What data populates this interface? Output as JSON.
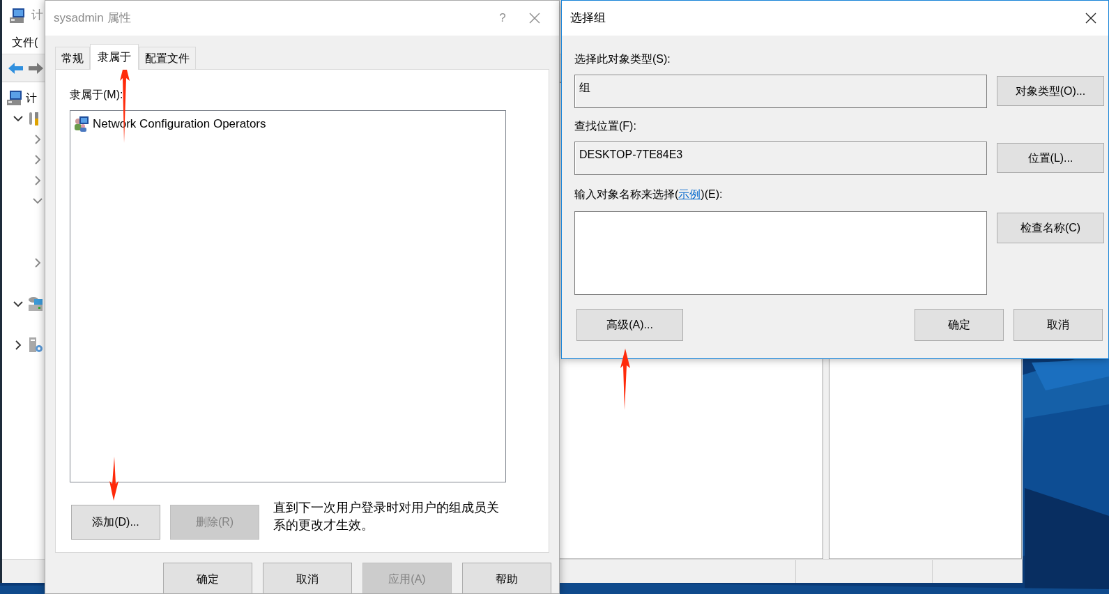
{
  "background_window": {
    "title": "计",
    "menu": [
      "文件("
    ],
    "tree": {
      "root": "计",
      "items": [
        {
          "kind": "tools",
          "expanded": true,
          "children": [
            {
              "kind": "node",
              "expanded": false
            },
            {
              "kind": "node",
              "expanded": false
            },
            {
              "kind": "node",
              "expanded": false
            },
            {
              "kind": "node",
              "expanded": true,
              "children": [
                {
                  "kind": "leaf"
                },
                {
                  "kind": "leaf"
                }
              ]
            },
            {
              "kind": "node",
              "expanded": false
            }
          ]
        },
        {
          "kind": "leaf"
        },
        {
          "kind": "storage",
          "expanded": true,
          "children": [
            {
              "kind": "leaf"
            }
          ]
        },
        {
          "kind": "services",
          "expanded": false
        }
      ]
    }
  },
  "properties_dialog": {
    "title": "sysadmin 属性",
    "help": "?",
    "tabs": [
      {
        "label": "常规",
        "selected": false
      },
      {
        "label": "隶属于",
        "selected": true
      },
      {
        "label": "配置文件",
        "selected": false
      }
    ],
    "member_of_label": "隶属于(M):",
    "members": [
      {
        "name": "Network Configuration Operators"
      }
    ],
    "buttons": [
      {
        "label": "添加(D)...",
        "disabled": false
      },
      {
        "label": "删除(R)",
        "disabled": true
      }
    ],
    "note": "直到下一次用户登录时对用户的组成员关系的更改才生效。",
    "footer_buttons": [
      {
        "label": "确定",
        "disabled": false
      },
      {
        "label": "取消",
        "disabled": false
      },
      {
        "label": "应用(A)",
        "disabled": true
      },
      {
        "label": "帮助",
        "disabled": false
      }
    ]
  },
  "select_dialog": {
    "title": "选择组",
    "object_type_label": "选择此对象类型(S):",
    "object_type_value": "组",
    "object_type_button": "对象类型(O)...",
    "location_label": "查找位置(F):",
    "location_value": "DESKTOP-7TE84E3",
    "location_button": "位置(L)...",
    "name_label": {
      "before": "输入对象名称来选择(",
      "link": "示例",
      "after": ")(E):"
    },
    "check_names_button": "检查名称(C)",
    "advanced_button": "高级(A)...",
    "ok_button": "确定",
    "cancel_button": "取消"
  }
}
